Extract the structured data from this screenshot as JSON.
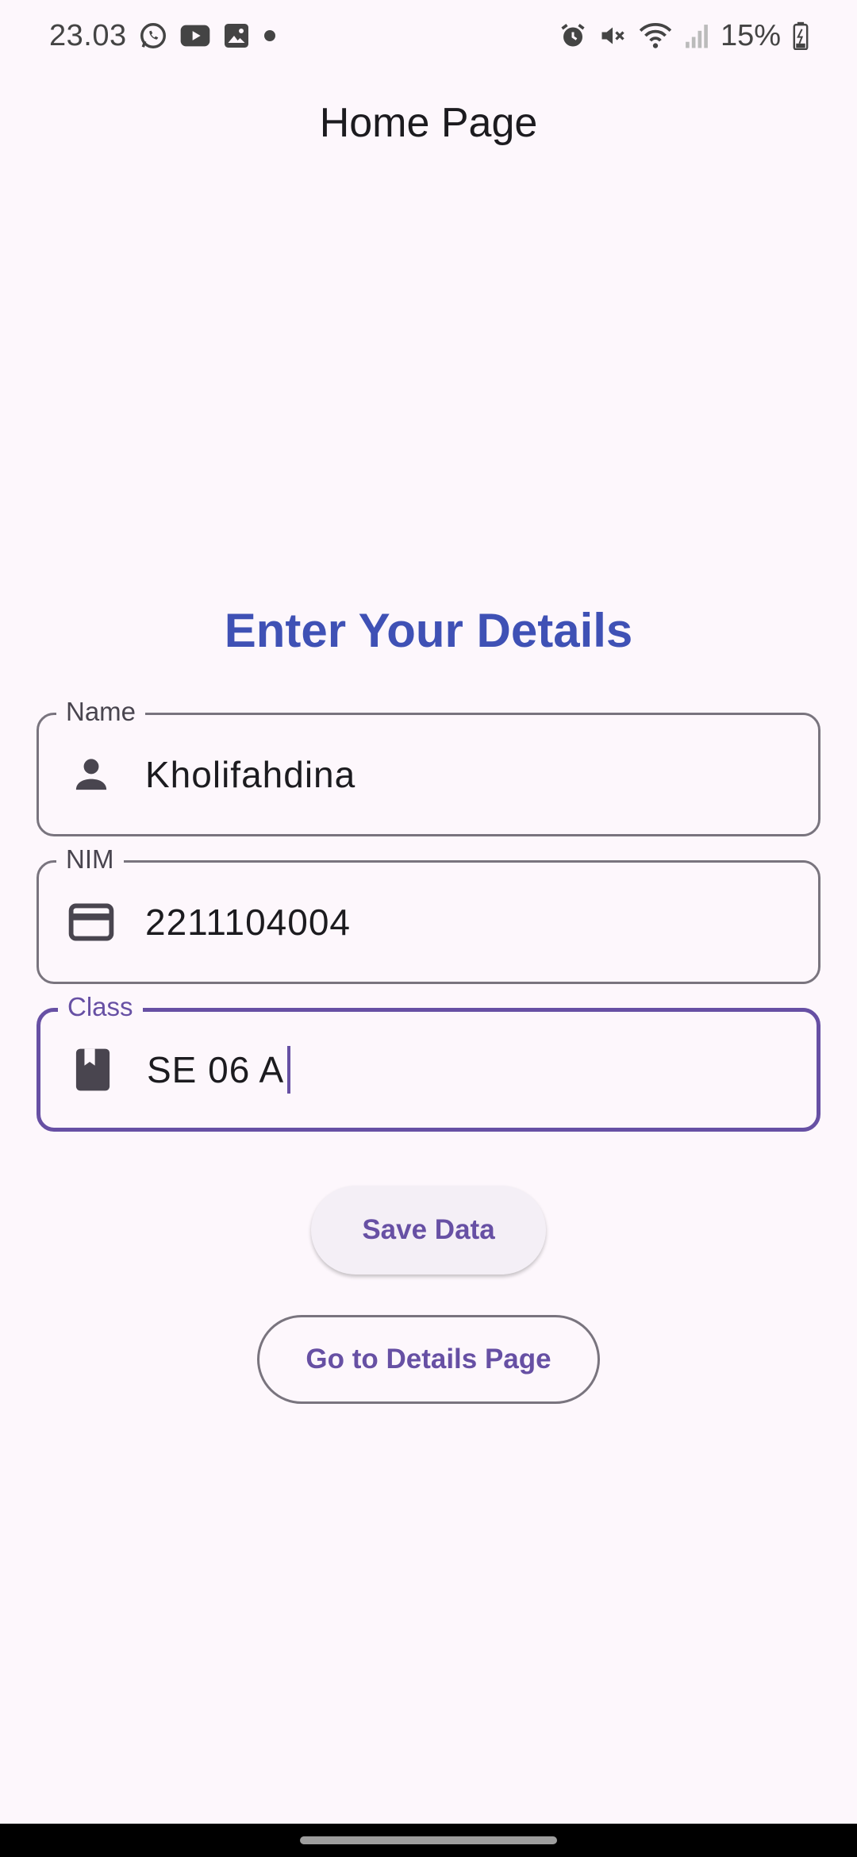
{
  "status_bar": {
    "time": "23.03",
    "battery_text": "15%",
    "left_icons": [
      "whatsapp-icon",
      "youtube-icon",
      "gallery-icon",
      "dot-icon"
    ],
    "right_icons": [
      "alarm-icon",
      "mute-icon",
      "wifi-icon",
      "signal-icon",
      "battery-icon"
    ]
  },
  "app_bar": {
    "title": "Home Page"
  },
  "form": {
    "heading": "Enter Your Details",
    "fields": [
      {
        "label": "Name",
        "value": "Kholifahdina",
        "icon": "person-icon",
        "focused": false
      },
      {
        "label": "NIM",
        "value": "2211104004",
        "icon": "credit-card-icon",
        "focused": false
      },
      {
        "label": "Class",
        "value": "SE 06 A",
        "icon": "book-icon",
        "focused": true
      }
    ]
  },
  "buttons": {
    "save_label": "Save Data",
    "details_label": "Go to Details Page"
  },
  "colors": {
    "background": "#fdf7fc",
    "heading": "#3f51b5",
    "primary": "#6750a4",
    "outline": "#79747e"
  }
}
